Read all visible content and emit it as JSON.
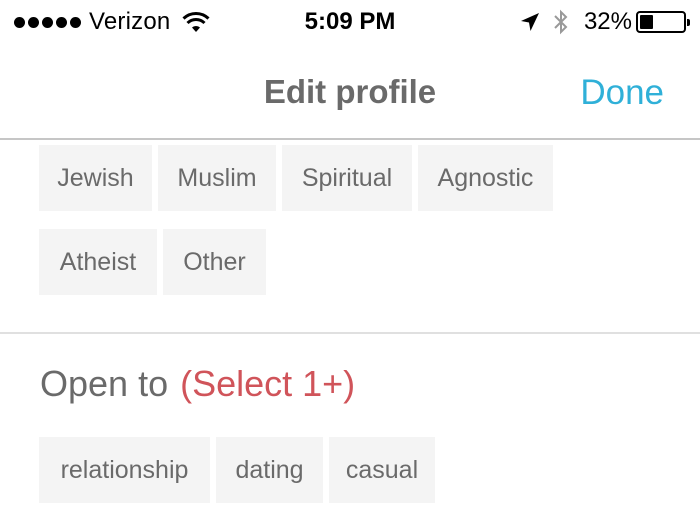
{
  "status_bar": {
    "signal_dots": 5,
    "carrier": "Verizon",
    "wifi_icon": "wifi-icon",
    "time": "5:09 PM",
    "location_icon": "location-arrow-icon",
    "bluetooth_icon": "bluetooth-icon",
    "battery_percent": "32%",
    "battery_level": 0.32
  },
  "nav": {
    "title": "Edit profile",
    "done_label": "Done",
    "accent_color": "#2fb0d8"
  },
  "religion": {
    "options_row1": [
      "Jewish",
      "Muslim",
      "Spiritual",
      "Agnostic"
    ],
    "options_row2": [
      "Atheist",
      "Other"
    ]
  },
  "open_to": {
    "title": "Open to",
    "requirement": "(Select 1+)",
    "requirement_color": "#d0545a",
    "options": [
      "relationship",
      "dating",
      "casual"
    ]
  }
}
